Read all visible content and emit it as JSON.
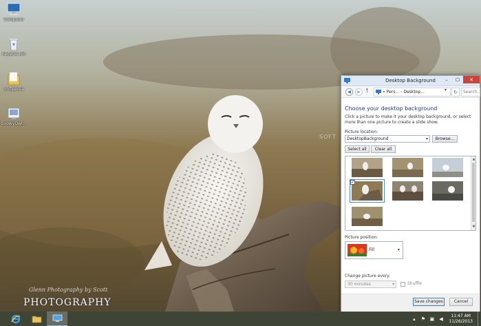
{
  "desktop": {
    "icons": [
      {
        "label": "Computer",
        "icon": "computer-icon"
      },
      {
        "label": "Recycle Bin",
        "icon": "recycle-bin-icon"
      },
      {
        "label": "Softpedia",
        "icon": "folder-icon"
      },
      {
        "label": "SnowyOwl...",
        "icon": "theme-file-icon"
      }
    ],
    "watermark": {
      "line1": "Glenn Photography by Scott",
      "line2": "PHOTOGRAPHY"
    },
    "softpedia_watermark": "SOFT"
  },
  "window": {
    "title": "Desktop Background",
    "caption": {
      "minimize": "–",
      "maximize": "☐",
      "close": "✕"
    },
    "address": {
      "crumb1": "Pers...",
      "crumb2": "Desktop...",
      "separator": "›",
      "more": "«",
      "search_placeholder": "Search..."
    },
    "heading": "Choose your desktop background",
    "description": "Click a picture to make it your desktop background, or select more than one picture to create a slide show.",
    "picture_location_label": "Picture location:",
    "picture_location_value": "DesktopBackground",
    "browse_label": "Browse...",
    "select_all_label": "Select all",
    "clear_all_label": "Clear all",
    "thumbnails": [
      {
        "name": "thumb-1",
        "selected": false
      },
      {
        "name": "thumb-2",
        "selected": false
      },
      {
        "name": "thumb-3",
        "selected": false
      },
      {
        "name": "thumb-4",
        "selected": true
      },
      {
        "name": "thumb-5",
        "selected": false
      },
      {
        "name": "thumb-6",
        "selected": false
      },
      {
        "name": "thumb-7",
        "selected": false
      }
    ],
    "picture_position_label": "Picture position:",
    "picture_position_value": "Fill",
    "change_every_label": "Change picture every:",
    "change_every_value": "30 minutes",
    "shuffle_label": "Shuffle",
    "save_label": "Save changes",
    "cancel_label": "Cancel"
  },
  "taskbar": {
    "clock_time": "11:47 AM",
    "clock_date": "11/26/2013"
  },
  "colors": {
    "accent": "#1e3a8c",
    "close": "#c7453a",
    "selection": "#4c8cd8"
  }
}
